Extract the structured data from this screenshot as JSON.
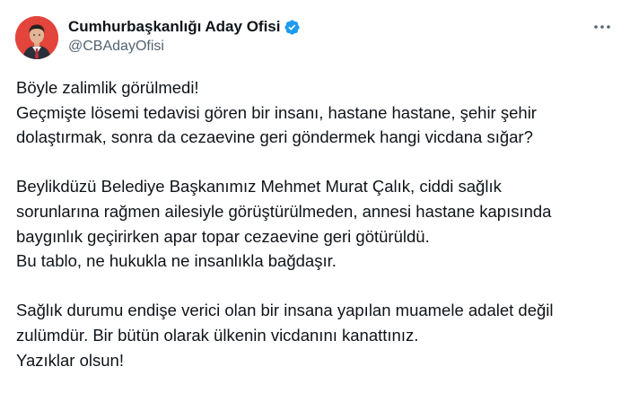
{
  "tweet": {
    "author": {
      "display_name": "Cumhurbaşkanlığı Aday Ofisi",
      "handle": "@CBAdayOfisi",
      "verified": true,
      "verified_color": "#1d9bf0",
      "avatar_background": "#e3443b"
    },
    "more_icon": "more-horizontal-icon",
    "paragraphs": [
      {
        "lines": [
          "Böyle zalimlik görülmedi!",
          "Geçmişte lösemi tedavisi gören bir insanı, hastane hastane, şehir şehir",
          "dolaştırmak, sonra da cezaevine geri göndermek hangi vicdana sığar?"
        ]
      },
      {
        "lines": [
          "Beylikdüzü Belediye Başkanımız Mehmet Murat Çalık, ciddi sağlık",
          "sorunlarına rağmen ailesiyle görüştürülmeden, annesi hastane kapısında",
          "baygınlık geçirirken apar topar cezaevine geri götürüldü.",
          "Bu tablo, ne hukukla ne insanlıkla bağdaşır."
        ]
      },
      {
        "lines": [
          "Sağlık durumu endişe verici olan bir insana yapılan muamele adalet değil",
          "zulümdür. Bir bütün olarak ülkenin vicdanını kanattınız.",
          "Yazıklar olsun!"
        ]
      }
    ]
  }
}
